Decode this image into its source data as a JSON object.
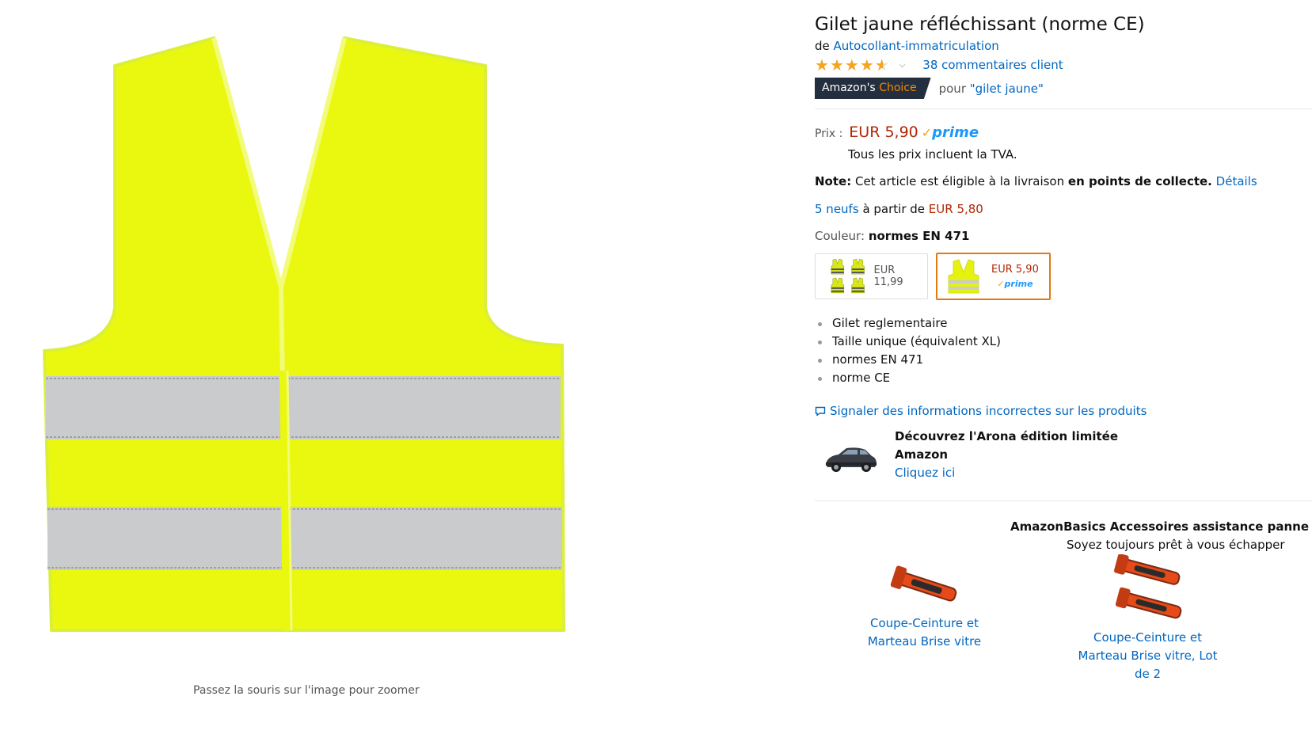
{
  "image": {
    "zoom_hint": "Passez la souris sur l'image pour zoomer"
  },
  "product": {
    "title": "Gilet jaune réfléchissant (norme CE)",
    "brand_prefix": "de",
    "brand": "Autocollant-immatriculation",
    "rating": {
      "stars": 4.5,
      "reviews_label": "38 commentaires client"
    },
    "choice": {
      "badge_main": "Amazon's",
      "badge_accent": "Choice",
      "for_prefix": "pour",
      "for_term": "\"gilet jaune\""
    }
  },
  "price": {
    "label": "Prix :",
    "value": "EUR 5,90",
    "prime": "prime",
    "tax_note": "Tous les prix incluent la TVA."
  },
  "note": {
    "label": "Note:",
    "text": "Cet article est éligible à la livraison",
    "bold": "en points de collecte.",
    "link": "Détails"
  },
  "offers": {
    "link": "5 neufs",
    "text": "à partir de",
    "price": "EUR 5,80"
  },
  "variation": {
    "label": "Couleur:",
    "value": "normes EN 471",
    "swatches": [
      {
        "price": "EUR 11,99",
        "selected": false
      },
      {
        "price": "EUR 5,90",
        "prime": "prime",
        "selected": true
      }
    ]
  },
  "bullets": [
    "Gilet reglementaire",
    "Taille unique (équivalent XL)",
    "normes EN 471",
    "norme CE"
  ],
  "report_link": "Signaler des informations incorrectes sur les produits",
  "ad": {
    "title": "Découvrez l'Arona édition limitée",
    "sponsor": "Amazon",
    "cta": "Cliquez ici"
  },
  "promo": {
    "title": "AmazonBasics Accessoires assistance panne pour au",
    "subtitle": "Soyez toujours prêt à vous échapper",
    "items": [
      {
        "line1": "Coupe-Ceinture et",
        "line2": "Marteau Brise vitre",
        "line3": ""
      },
      {
        "line1": "Coupe-Ceinture et",
        "line2": "Marteau Brise vitre, Lot",
        "line3": "de 2"
      }
    ]
  },
  "colors": {
    "link": "#0066c0",
    "price": "#b12704",
    "vest": "#eaf80f",
    "reflective": "#c9cbcd",
    "badge_bg": "#232f3e",
    "badge_accent": "#f08804",
    "star": "#f4a41d",
    "selected_border": "#e47911"
  }
}
